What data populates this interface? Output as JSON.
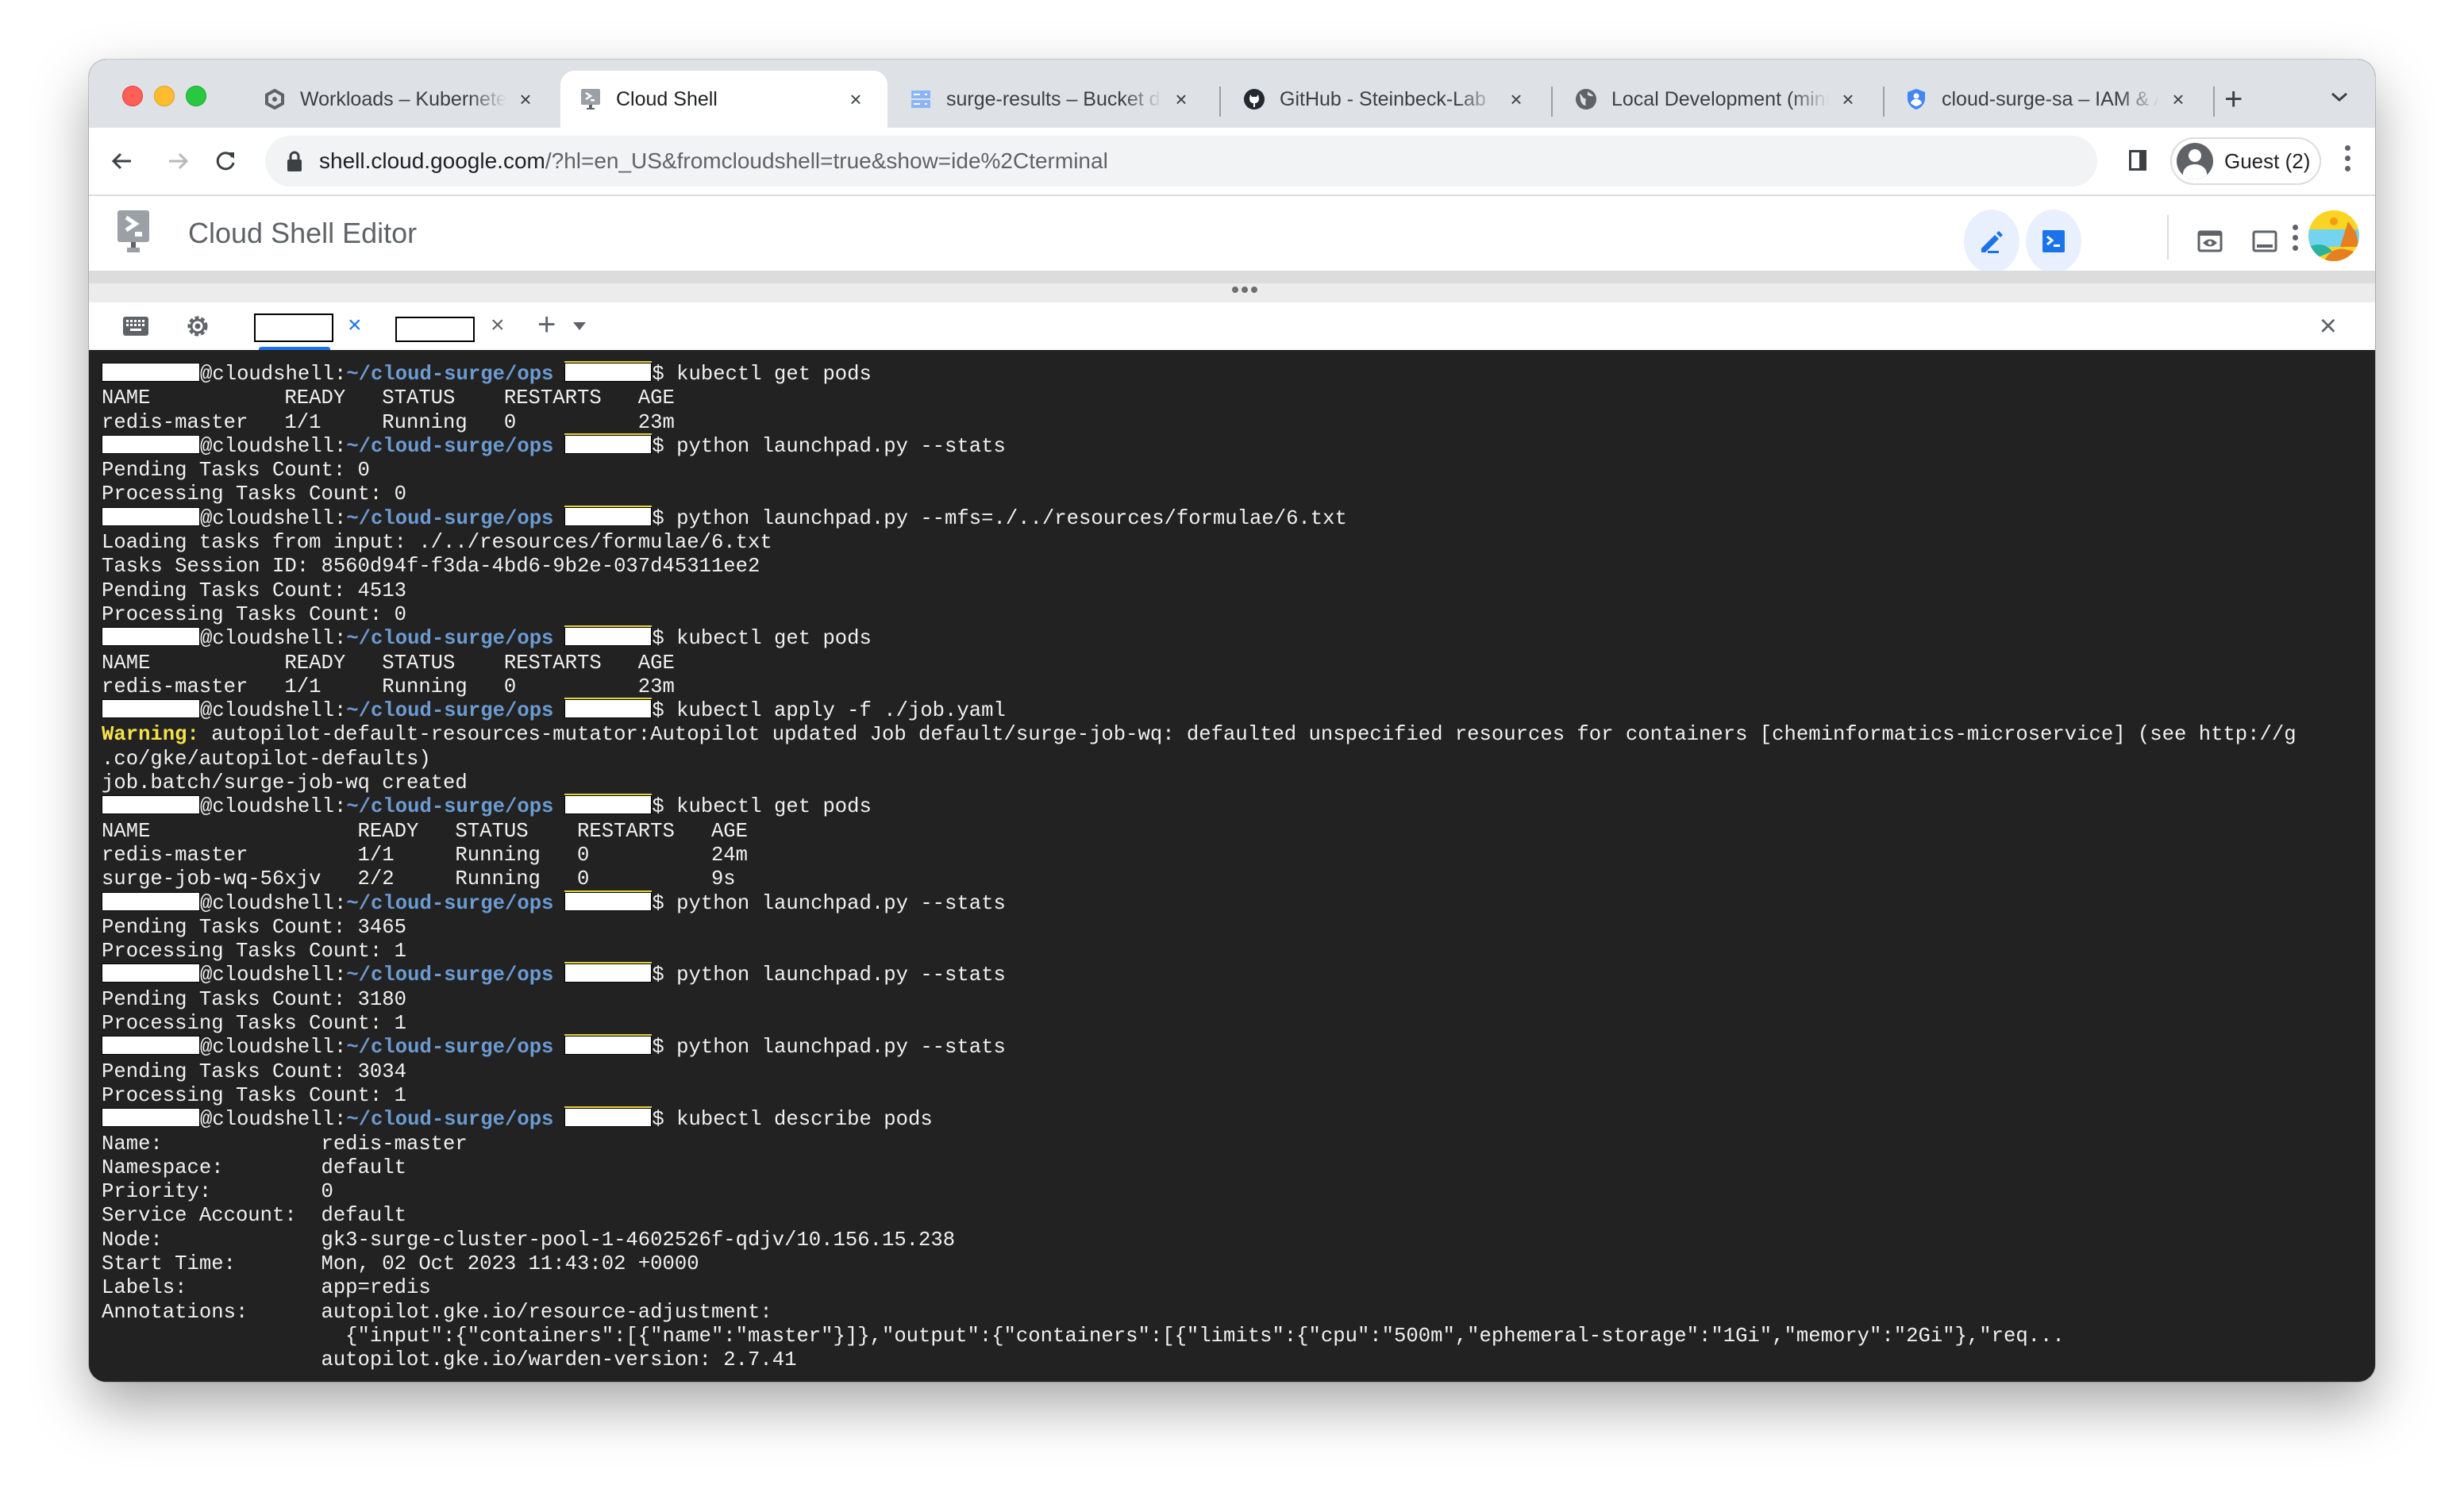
{
  "browser": {
    "tabs": [
      {
        "title": "Workloads – Kubernetes Engine",
        "icon": "kubernetes-engine-icon",
        "active": false
      },
      {
        "title": "Cloud Shell",
        "icon": "cloud-shell-icon",
        "active": true
      },
      {
        "title": "surge-results – Bucket details",
        "icon": "cloud-storage-icon",
        "active": false
      },
      {
        "title": "GitHub - Steinbeck-Lab",
        "icon": "github-icon",
        "active": false
      },
      {
        "title": "Local Development (minikube)",
        "icon": "globe-icon",
        "active": false
      },
      {
        "title": "cloud-surge-sa – IAM & Admin",
        "icon": "iam-shield-icon",
        "active": false
      }
    ],
    "tab_close_label": "×",
    "new_tab_label": "+",
    "url_domain": "shell.cloud.google.com",
    "url_rest": "/?hl=en_US&fromcloudshell=true&show=ide%2Cterminal",
    "profile_label": "Guest (2)"
  },
  "editor": {
    "title": "Cloud Shell Editor",
    "buttons": [
      "open-editor",
      "open-terminal",
      "web-preview",
      "toggle-panel",
      "more-options"
    ]
  },
  "terminal_tabs": {
    "close_label": "×",
    "add_label": "+",
    "close_panel_label": "×"
  },
  "terminal": {
    "prompt_host": "@cloudshell:",
    "prompt_path": "~/cloud-surge/ops",
    "prompt_symbol": "$ ",
    "lines": [
      {
        "type": "prompt",
        "cmd": "kubectl get pods"
      },
      {
        "type": "out",
        "text": "NAME           READY   STATUS    RESTARTS   AGE"
      },
      {
        "type": "out",
        "text": "redis-master   1/1     Running   0          23m"
      },
      {
        "type": "prompt",
        "cmd": "python launchpad.py --stats"
      },
      {
        "type": "out",
        "text": "Pending Tasks Count: 0"
      },
      {
        "type": "out",
        "text": "Processing Tasks Count: 0"
      },
      {
        "type": "prompt",
        "cmd": "python launchpad.py --mfs=./../resources/formulae/6.txt"
      },
      {
        "type": "out",
        "text": "Loading tasks from input: ./../resources/formulae/6.txt"
      },
      {
        "type": "out",
        "text": "Tasks Session ID: 8560d94f-f3da-4bd6-9b2e-037d45311ee2"
      },
      {
        "type": "out",
        "text": "Pending Tasks Count: 4513"
      },
      {
        "type": "out",
        "text": "Processing Tasks Count: 0"
      },
      {
        "type": "prompt",
        "cmd": "kubectl get pods"
      },
      {
        "type": "out",
        "text": "NAME           READY   STATUS    RESTARTS   AGE"
      },
      {
        "type": "out",
        "text": "redis-master   1/1     Running   0          23m"
      },
      {
        "type": "prompt",
        "cmd": "kubectl apply -f ./job.yaml"
      },
      {
        "type": "warn",
        "label": "Warning:",
        "text": " autopilot-default-resources-mutator:Autopilot updated Job default/surge-job-wq: defaulted unspecified resources for containers [cheminformatics-microservice] (see http://g"
      },
      {
        "type": "out",
        "text": ".co/gke/autopilot-defaults)"
      },
      {
        "type": "out",
        "text": "job.batch/surge-job-wq created"
      },
      {
        "type": "prompt",
        "cmd": "kubectl get pods"
      },
      {
        "type": "out",
        "text": "NAME                 READY   STATUS    RESTARTS   AGE"
      },
      {
        "type": "out",
        "text": "redis-master         1/1     Running   0          24m"
      },
      {
        "type": "out",
        "text": "surge-job-wq-56xjv   2/2     Running   0          9s"
      },
      {
        "type": "prompt",
        "cmd": "python launchpad.py --stats"
      },
      {
        "type": "out",
        "text": "Pending Tasks Count: 3465"
      },
      {
        "type": "out",
        "text": "Processing Tasks Count: 1"
      },
      {
        "type": "prompt",
        "cmd": "python launchpad.py --stats"
      },
      {
        "type": "out",
        "text": "Pending Tasks Count: 3180"
      },
      {
        "type": "out",
        "text": "Processing Tasks Count: 1"
      },
      {
        "type": "prompt",
        "cmd": "python launchpad.py --stats"
      },
      {
        "type": "out",
        "text": "Pending Tasks Count: 3034"
      },
      {
        "type": "out",
        "text": "Processing Tasks Count: 1"
      },
      {
        "type": "prompt",
        "cmd": "kubectl describe pods"
      },
      {
        "type": "out",
        "text": "Name:             redis-master"
      },
      {
        "type": "out",
        "text": "Namespace:        default"
      },
      {
        "type": "out",
        "text": "Priority:         0"
      },
      {
        "type": "out",
        "text": "Service Account:  default"
      },
      {
        "type": "out",
        "text": "Node:             gk3-surge-cluster-pool-1-4602526f-qdjv/10.156.15.238"
      },
      {
        "type": "out",
        "text": "Start Time:       Mon, 02 Oct 2023 11:43:02 +0000"
      },
      {
        "type": "out",
        "text": "Labels:           app=redis"
      },
      {
        "type": "out",
        "text": "Annotations:      autopilot.gke.io/resource-adjustment:"
      },
      {
        "type": "out",
        "text": "                    {\"input\":{\"containers\":[{\"name\":\"master\"}]},\"output\":{\"containers\":[{\"limits\":{\"cpu\":\"500m\",\"ephemeral-storage\":\"1Gi\",\"memory\":\"2Gi\"},\"req..."
      },
      {
        "type": "out",
        "text": "                  autopilot.gke.io/warden-version: 2.7.41"
      }
    ]
  },
  "colors": {
    "terminal_bg": "#222222",
    "prompt_path": "#6c9bd2",
    "warning": "#f5e24a",
    "accent": "#1a73e8"
  }
}
